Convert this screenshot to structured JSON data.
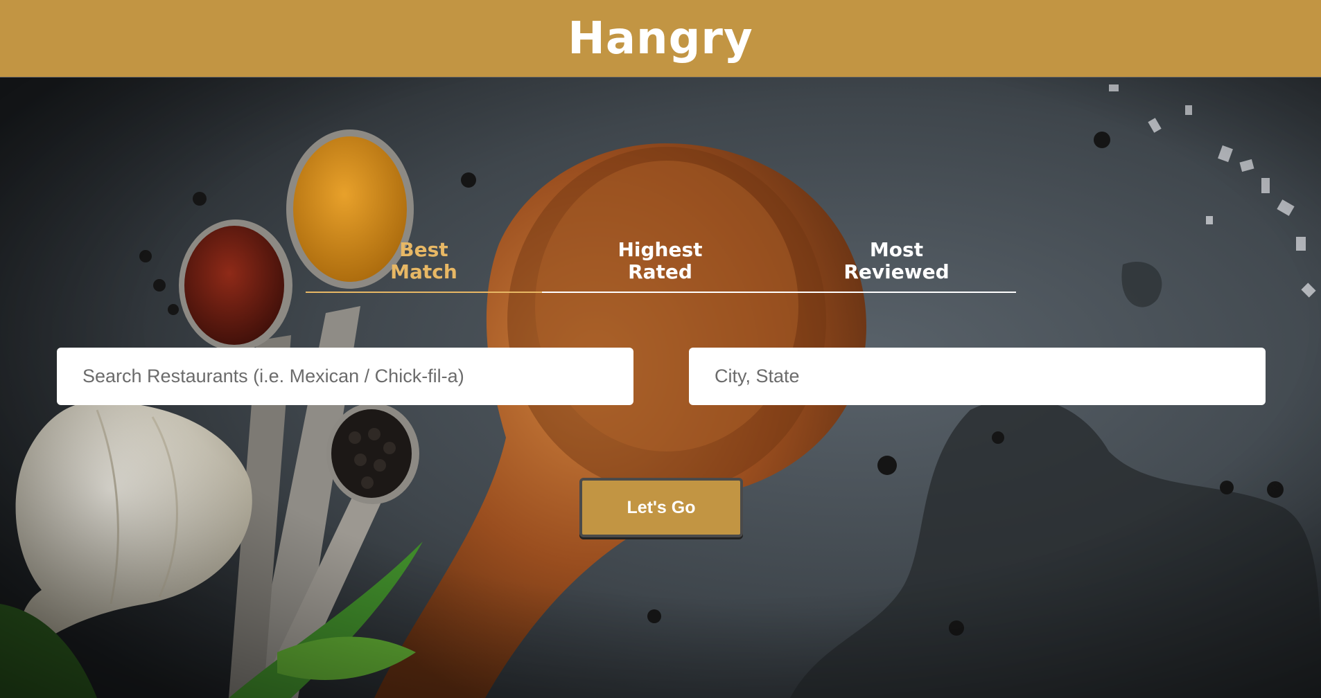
{
  "header": {
    "title": "Hangry"
  },
  "tabs": [
    {
      "line1": "Best",
      "line2": "Match",
      "active": true
    },
    {
      "line1": "Highest",
      "line2": "Rated",
      "active": false
    },
    {
      "line1": "Most",
      "line2": "Reviewed",
      "active": false
    }
  ],
  "search": {
    "placeholder": "Search Restaurants (i.e. Mexican / Chick-fil-a)",
    "value": ""
  },
  "location": {
    "placeholder": "City, State",
    "value": ""
  },
  "submit": {
    "label": "Let's Go"
  },
  "colors": {
    "brand": "#c29543",
    "active_tab": "#e8b865",
    "text": "#ffffff"
  },
  "background": {
    "image": "cooking-spoons-spices-on-slate"
  }
}
